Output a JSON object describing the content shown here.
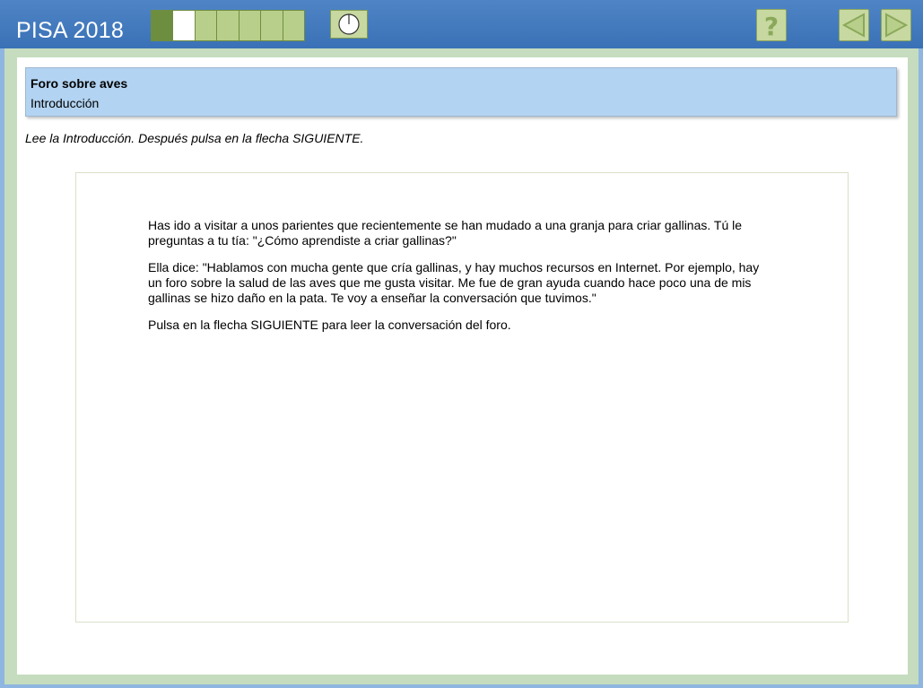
{
  "header": {
    "brand": "PISA 2018",
    "progress": {
      "segments": 7,
      "completed": 1,
      "current_index": 1
    },
    "buttons": {
      "timer_icon": "clock-icon",
      "help_icon": "question-mark-icon",
      "back_icon": "left-arrow-icon",
      "next_icon": "right-arrow-icon"
    }
  },
  "unit": {
    "title": "Foro sobre aves",
    "subtitle": "Introducción"
  },
  "instruction": "Lee la Introducción. Después pulsa en la flecha SIGUIENTE.",
  "stimulus": {
    "paragraphs": [
      "Has ido a visitar a unos parientes que recientemente se han mudado a una granja para criar gallinas. Tú le preguntas a tu tía: \"¿Cómo aprendiste a criar gallinas?\"",
      "Ella dice: \"Hablamos con mucha gente que cría gallinas, y hay muchos recursos en Internet. Por ejemplo, hay un foro sobre la salud de las aves que me gusta visitar. Me fue de gran ayuda cuando hace poco una de mis gallinas se hizo daño en la pata. Te voy a enseñar la conversación que tuvimos.\"",
      "Pulsa en la flecha SIGUIENTE para leer la conversación del foro."
    ]
  },
  "colors": {
    "topbar": "#3f78bd",
    "frame": "#c5dcbe",
    "title_box": "#b2d3f1",
    "button_green": "#c7d8a0",
    "icon_green": "#8aa85a"
  }
}
